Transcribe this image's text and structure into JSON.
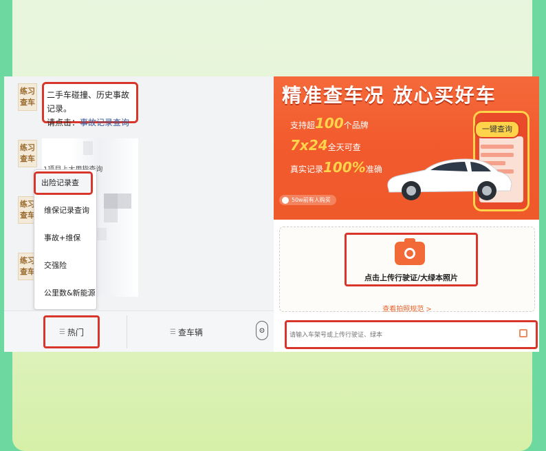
{
  "chat": {
    "avatar_text": "练习\n查车",
    "bubble_line1": "二手车碰撞、历史事故记录。",
    "bubble_prefix": "请点击：",
    "bubble_link": "事故记录查询",
    "partial_text": "1项目上大用指查询"
  },
  "menu": {
    "items": [
      "出险记录查",
      "维保记录查询",
      "事故+维保",
      "交强险",
      "公里数&新能源"
    ]
  },
  "tabbar": {
    "tab1": "热门",
    "tab2": "查车辆"
  },
  "banner": {
    "slogan": "精准查车况 放心买好车",
    "f1_pre": "支持超",
    "f1_num": "100",
    "f1_post": "个品牌",
    "f2_num": "7x24",
    "f2_post": "全天可查",
    "f3_pre": "真实记录",
    "f3_num": "100%",
    "f3_post": "准确",
    "pill": "一键查询",
    "badge": "50w前有人购买"
  },
  "upload": {
    "text": "点击上传行驶证/大绿本照片",
    "guide": "查看拍照规范 >"
  },
  "search": {
    "placeholder": "请输入车架号或上传行驶证、绿本"
  },
  "colors": {
    "accent": "#d8362a",
    "banner": "#f15a2c",
    "gold": "#ffd34a"
  }
}
